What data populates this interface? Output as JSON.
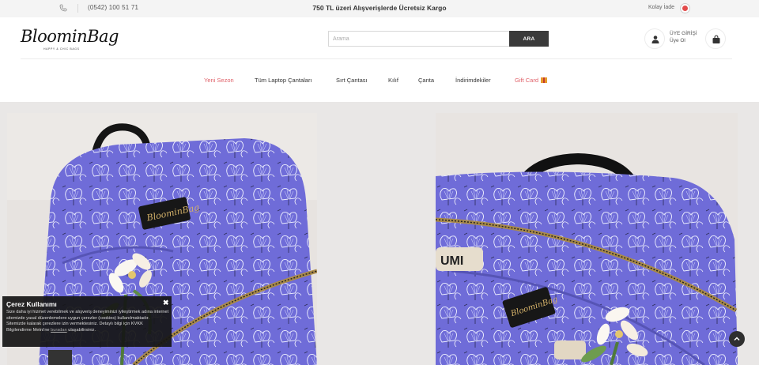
{
  "topbar": {
    "phone": "(0542) 100 51 71",
    "promo": "750 TL üzeri Alışverişlerde Ücretsiz Kargo",
    "easy_return": "Kolay İade"
  },
  "header": {
    "logo_text": "BloominBag",
    "logo_sub": "HAPPY & CHIC BAGS",
    "search": {
      "placeholder": "Arama",
      "button_label": "ARA"
    },
    "user": {
      "login_label": "ÜYE GİRİŞİ",
      "signup_label": "Üye Ol"
    }
  },
  "nav": {
    "items": [
      {
        "label": "Yeni Sezon"
      },
      {
        "label": "Tüm Laptop Çantaları"
      },
      {
        "label": "Sırt Çantası"
      },
      {
        "label": "Kılıf"
      },
      {
        "label": "Çanta"
      },
      {
        "label": "İndirimdekiler"
      },
      {
        "label": "Gift Card"
      }
    ]
  },
  "banner": {
    "bag_label": "BloominBag",
    "bag_label_sub": "HAPPY & CHIC BAGS",
    "keychain": "UMI"
  },
  "cookie": {
    "title": "Çerez Kullanımı",
    "text": "Size daha iyi hizmet verebilmek ve alışveriş deneyiminizi iyileştirmek adına internet sitemizde yasal düzenlemelere uygun çerezler (cookies) kullanılmaktadır. Sitemizde kalarak çerezlere izin vermektesiniz. Detaylı bilgi için KVKK Bilgilendirme Metni'ne",
    "link": "buradan",
    "text_end": "ulaşabilirsiniz."
  },
  "colors": {
    "accent": "#e0626a",
    "dark_button": "#3a3a3a",
    "bag_purple": "#6f6cd8"
  }
}
